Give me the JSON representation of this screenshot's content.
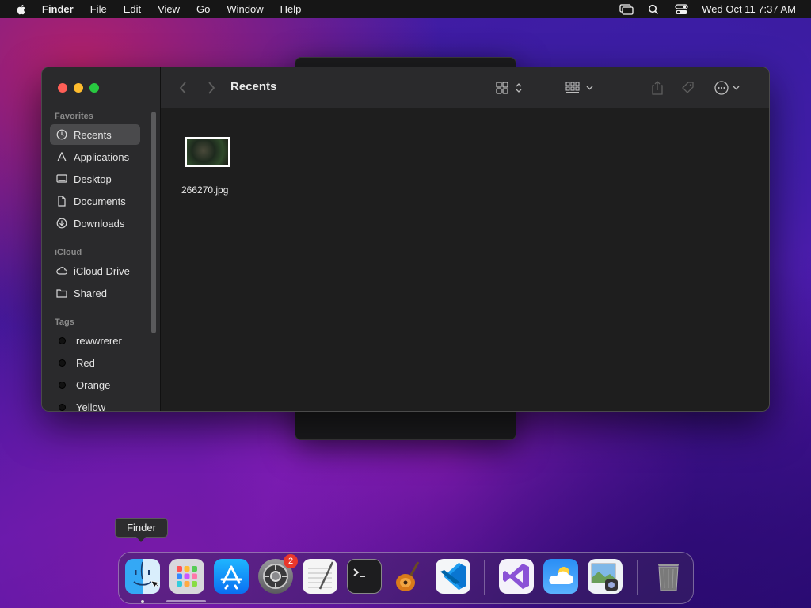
{
  "menubar": {
    "app_name": "Finder",
    "items": [
      "File",
      "Edit",
      "View",
      "Go",
      "Window",
      "Help"
    ],
    "clock": "Wed Oct 11  7:37 AM"
  },
  "finder": {
    "title": "Recents",
    "sidebar": {
      "favorites_header": "Favorites",
      "favorites": [
        {
          "label": "Recents",
          "icon": "clock-icon",
          "selected": true
        },
        {
          "label": "Applications",
          "icon": "applications-icon"
        },
        {
          "label": "Desktop",
          "icon": "desktop-icon"
        },
        {
          "label": "Documents",
          "icon": "document-icon"
        },
        {
          "label": "Downloads",
          "icon": "download-icon"
        }
      ],
      "icloud_header": "iCloud",
      "icloud": [
        {
          "label": "iCloud Drive",
          "icon": "cloud-icon"
        },
        {
          "label": "Shared",
          "icon": "shared-folder-icon"
        }
      ],
      "tags_header": "Tags",
      "tags": [
        {
          "label": "rewwrerer"
        },
        {
          "label": "Red"
        },
        {
          "label": "Orange"
        },
        {
          "label": "Yellow"
        }
      ]
    },
    "files": [
      {
        "name": "266270.jpg"
      }
    ]
  },
  "tooltip": "Finder",
  "dock": {
    "apps": [
      {
        "name": "Finder",
        "icon": "finder-icon",
        "running": true
      },
      {
        "name": "Launchpad",
        "icon": "launchpad-icon"
      },
      {
        "name": "App Store",
        "icon": "app-store-icon"
      },
      {
        "name": "System Settings",
        "icon": "settings-icon",
        "badge": "2"
      },
      {
        "name": "TextEdit",
        "icon": "textedit-icon"
      },
      {
        "name": "Terminal",
        "icon": "terminal-icon"
      },
      {
        "name": "GarageBand",
        "icon": "guitar-icon"
      },
      {
        "name": "Visual Studio Code",
        "icon": "vscode-icon"
      },
      {
        "name": "Visual Studio",
        "icon": "visual-studio-icon"
      },
      {
        "name": "Weather",
        "icon": "weather-icon"
      },
      {
        "name": "Preview",
        "icon": "preview-icon"
      },
      {
        "name": "Trash",
        "icon": "trash-icon"
      }
    ]
  },
  "colors": {
    "accent_red": "#ff5f57",
    "accent_yellow": "#febc2e",
    "accent_green": "#28c840",
    "badge_red": "#e8372c",
    "vscode_blue": "#0a76d1",
    "vs_purple": "#8a52d6"
  }
}
